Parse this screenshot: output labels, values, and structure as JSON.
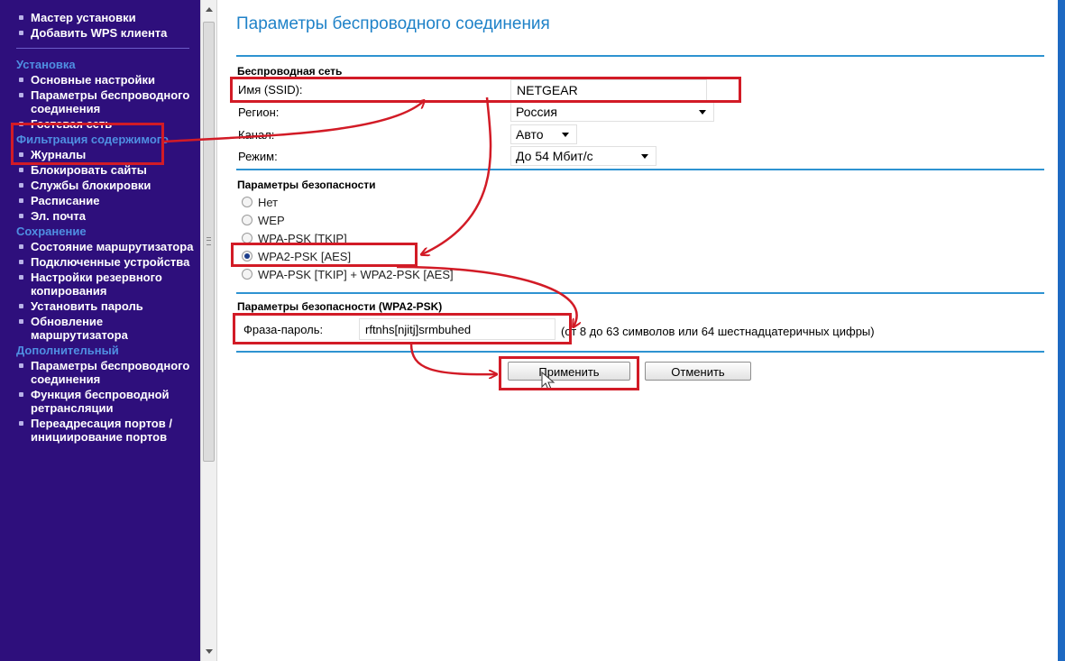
{
  "sidebar": {
    "items_top": [
      {
        "label": "Мастер установки",
        "type": "item"
      },
      {
        "label": "Добавить WPS клиента",
        "type": "item"
      }
    ],
    "items": [
      {
        "label": "Установка",
        "type": "head"
      },
      {
        "label": "Основные настройки",
        "type": "item"
      },
      {
        "label": "Параметры беспроводного соединения",
        "type": "item"
      },
      {
        "label": "Гостевая сеть",
        "type": "item"
      },
      {
        "label": "Фильтрация содержимого",
        "type": "head"
      },
      {
        "label": "Журналы",
        "type": "item"
      },
      {
        "label": "Блокировать сайты",
        "type": "item"
      },
      {
        "label": "Службы блокировки",
        "type": "item"
      },
      {
        "label": "Расписание",
        "type": "item"
      },
      {
        "label": "Эл. почта",
        "type": "item"
      },
      {
        "label": "Сохранение",
        "type": "head"
      },
      {
        "label": "Состояние маршрутизатора",
        "type": "item"
      },
      {
        "label": "Подключенные устройства",
        "type": "item"
      },
      {
        "label": "Настройки резервного копирования",
        "type": "item"
      },
      {
        "label": "Установить пароль",
        "type": "item"
      },
      {
        "label": "Обновление маршрутизатора",
        "type": "item"
      },
      {
        "label": "Дополнительный",
        "type": "head"
      },
      {
        "label": "Параметры беспроводного соединения",
        "type": "item"
      },
      {
        "label": "Функция беспроводной ретрансляции",
        "type": "item"
      },
      {
        "label": "Переадресация портов / инициирование портов",
        "type": "item"
      }
    ]
  },
  "main": {
    "title": "Параметры беспроводного соединения",
    "wireless": {
      "section_title": "Беспроводная сеть",
      "ssid_label": "Имя (SSID):",
      "ssid_value": "NETGEAR",
      "region_label": "Регион:",
      "region_value": "Россия",
      "channel_label": "Канал:",
      "channel_value": "Авто",
      "mode_label": "Режим:",
      "mode_value": "До 54 Мбит/с"
    },
    "security": {
      "section_title": "Параметры безопасности",
      "options": [
        "Нет",
        "WEP",
        "WPA-PSK [TKIP]",
        "WPA2-PSK [AES]",
        "WPA-PSK [TKIP] + WPA2-PSK [AES]"
      ],
      "selected": "WPA2-PSK [AES]"
    },
    "wpa2": {
      "section_title": "Параметры безопасности (WPA2-PSK)",
      "passphrase_label": "Фраза-пароль:",
      "passphrase_value": "rftnhs[njitj]srmbuhed",
      "hint": "(от 8 до 63 символов или 64 шестнадцатеричных цифры)"
    },
    "buttons": {
      "apply": "Применить",
      "cancel": "Отменить"
    }
  },
  "colors": {
    "sidebar_bg": "#2e0f7c",
    "sidebar_head": "#4f8fe2",
    "title": "#1f82c8",
    "rule": "#2e93d1",
    "highlight": "#d21b26"
  }
}
